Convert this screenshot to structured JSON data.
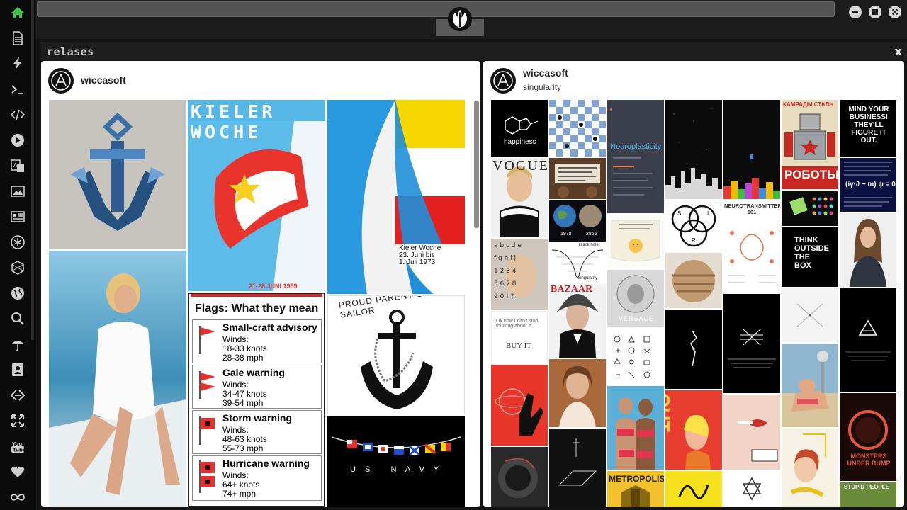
{
  "sidebar": {
    "items": [
      "home-icon",
      "document-icon",
      "bolt-icon",
      "terminal-icon",
      "code-icon",
      "play-icon",
      "translate-icon",
      "image-icon",
      "news-icon",
      "asterisk-icon",
      "hexagon-icon",
      "globe-icon",
      "search-icon",
      "umbrella-icon",
      "contact-icon",
      "exchange-icon",
      "expand-icon",
      "youtube-icon",
      "heart-icon",
      "infinity-icon"
    ],
    "youtube_label": "You Tube"
  },
  "column": {
    "title": "relases",
    "close_label": "x"
  },
  "cards": [
    {
      "username": "wiccasoft",
      "subtitle": "",
      "tiles": {
        "kieler_title": "KIELER WOCHE",
        "kieler_dates": "21-28 JUNI 1959",
        "poster_text": "Kieler Woche 23. Juni bis 1. Juli 1973",
        "proud_text": "PROUD PARENT OF A U.S. SAILOR",
        "navy_text": "U S   N A V Y",
        "flags_title": "Flags: What they mean",
        "flags": [
          {
            "name": "Small-craft advisory",
            "l1": "Winds:",
            "l2": "18-33 knots",
            "l3": "28-38 mph"
          },
          {
            "name": "Gale warning",
            "l1": "Winds:",
            "l2": "34-47 knots",
            "l3": "39-54 mph"
          },
          {
            "name": "Storm warning",
            "l1": "Winds:",
            "l2": "48-63 knots",
            "l3": "55-73 mph"
          },
          {
            "name": "Hurricane warning",
            "l1": "Winds:",
            "l2": "64+ knots",
            "l3": "74+ mph"
          }
        ]
      }
    },
    {
      "username": "wiccasoft",
      "subtitle": "singularity",
      "tiles": {
        "happiness": "happiness",
        "neuro": "Neuroplasticity",
        "neuro_tx": "NEUROTRANSMITTERS 101",
        "mind_business": "MIND YOUR BUSINESS! THEY'LL FIGURE IT OUT.",
        "roboty": "РОБОТЫ",
        "kamrady": "КАМРАДЫ СТАЛЬ",
        "dirac": "(iγ·∂ − m) ψ = 0",
        "think": "THINK OUTSIDE THE BOX",
        "buy_it": "BUY IT",
        "stop_thinking": "Ok now I can't stop thinking about it...",
        "year_1978": "1978",
        "year_2866": "2866",
        "blackhole": "Black hole",
        "singularity_label": "Singularity",
        "venn_s": "S",
        "venn_i": "I",
        "venn_r": "R",
        "versace": "VERSACE",
        "bazaar": "BAZAAR",
        "monsters": "MONSTERS UNDER BUMP",
        "stupid": "STUPID PEOPLE",
        "out": "OUT",
        "metropolis": "METROPOLIS",
        "vogue": "VOGUE"
      }
    }
  ]
}
